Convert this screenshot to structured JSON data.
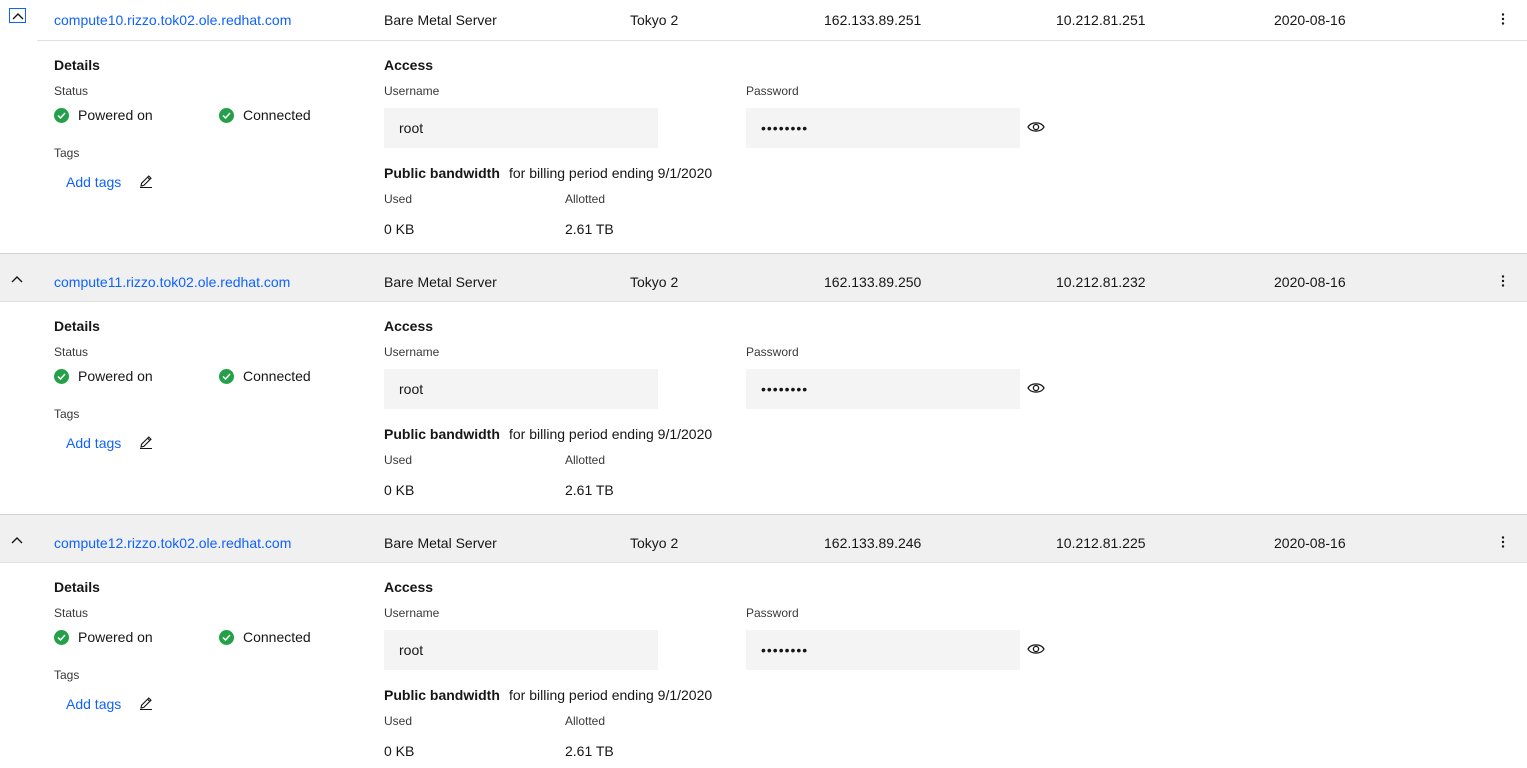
{
  "devices": [
    {
      "hostname": "compute10.rizzo.tok02.ole.redhat.com",
      "type": "Bare Metal Server",
      "location": "Tokyo 2",
      "public_ip": "162.133.89.251",
      "private_ip": "10.212.81.251",
      "date": "2020-08-16",
      "details": {
        "title": "Details",
        "status_label": "Status",
        "power_status": "Powered on",
        "connection_status": "Connected",
        "tags_label": "Tags",
        "add_tags": "Add tags"
      },
      "access": {
        "title": "Access",
        "username_label": "Username",
        "username": "root",
        "password_label": "Password",
        "password": "••••••••"
      },
      "bandwidth": {
        "title": "Public bandwidth",
        "subtitle": "for billing period ending 9/1/2020",
        "used_label": "Used",
        "used": "0 KB",
        "allotted_label": "Allotted",
        "allotted": "2.61 TB"
      }
    },
    {
      "hostname": "compute11.rizzo.tok02.ole.redhat.com",
      "type": "Bare Metal Server",
      "location": "Tokyo 2",
      "public_ip": "162.133.89.250",
      "private_ip": "10.212.81.232",
      "date": "2020-08-16",
      "details": {
        "title": "Details",
        "status_label": "Status",
        "power_status": "Powered on",
        "connection_status": "Connected",
        "tags_label": "Tags",
        "add_tags": "Add tags"
      },
      "access": {
        "title": "Access",
        "username_label": "Username",
        "username": "root",
        "password_label": "Password",
        "password": "••••••••"
      },
      "bandwidth": {
        "title": "Public bandwidth",
        "subtitle": "for billing period ending 9/1/2020",
        "used_label": "Used",
        "used": "0 KB",
        "allotted_label": "Allotted",
        "allotted": "2.61 TB"
      }
    },
    {
      "hostname": "compute12.rizzo.tok02.ole.redhat.com",
      "type": "Bare Metal Server",
      "location": "Tokyo 2",
      "public_ip": "162.133.89.246",
      "private_ip": "10.212.81.225",
      "date": "2020-08-16",
      "details": {
        "title": "Details",
        "status_label": "Status",
        "power_status": "Powered on",
        "connection_status": "Connected",
        "tags_label": "Tags",
        "add_tags": "Add tags"
      },
      "access": {
        "title": "Access",
        "username_label": "Username",
        "username": "root",
        "password_label": "Password",
        "password": "••••••••"
      },
      "bandwidth": {
        "title": "Public bandwidth",
        "subtitle": "for billing period ending 9/1/2020",
        "used_label": "Used",
        "used": "0 KB",
        "allotted_label": "Allotted",
        "allotted": "2.61 TB"
      }
    }
  ],
  "icons": {
    "toggle": "chevron-up-icon",
    "status": "checkmark-filled-icon",
    "edit": "pencil-icon",
    "reveal": "eye-icon",
    "menu": "overflow-menu-vertical-icon"
  },
  "colors": {
    "link": "#0f62fe",
    "success": "#24a148",
    "field_bg": "#f4f4f4",
    "row_header_bg": "#f0f0f0"
  }
}
